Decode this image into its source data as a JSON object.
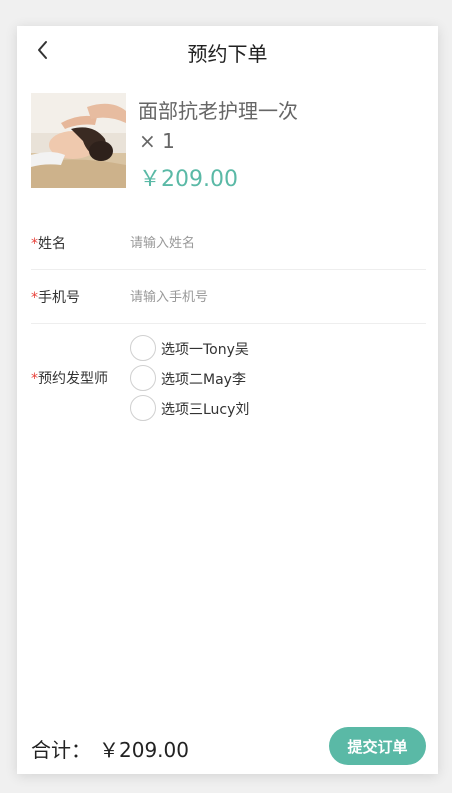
{
  "header": {
    "title": "预约下单",
    "back_icon": "chevron-left-icon"
  },
  "product": {
    "name": "面部抗老护理一次",
    "quantity": "× 1",
    "price": "￥209.00"
  },
  "form": {
    "name": {
      "required_mark": "*",
      "label": "姓名",
      "placeholder": "请输入姓名",
      "value": ""
    },
    "phone": {
      "required_mark": "*",
      "label": "手机号",
      "placeholder": "请输入手机号",
      "value": ""
    },
    "stylist": {
      "required_mark": "*",
      "label": "预约发型师",
      "options": [
        "选项一Tony吴",
        "选项二May李",
        "选项三Lucy刘"
      ]
    }
  },
  "footer": {
    "total_label": "合计：",
    "total_value": "￥209.00",
    "submit_label": "提交订单"
  },
  "colors": {
    "accent": "#5ab9a6",
    "required": "#e8413a"
  }
}
